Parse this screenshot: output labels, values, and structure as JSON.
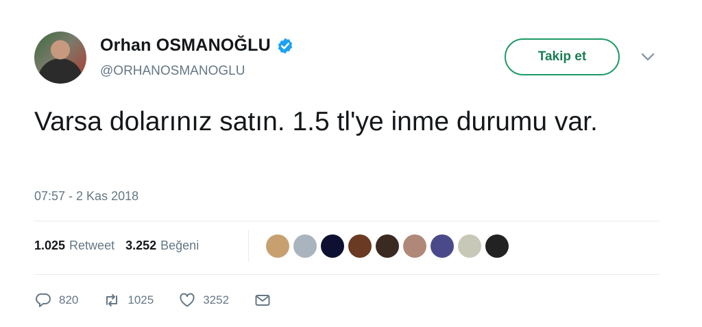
{
  "user": {
    "display_name": "Orhan OSMANOĞLU",
    "handle": "@ORHANOSMANOGLU",
    "verified_color": "#1da1f2"
  },
  "follow_button": {
    "label": "Takip et",
    "color": "#1b9a64"
  },
  "tweet": {
    "text": "Varsa dolarınız satın. 1.5 tl'ye inme durumu var.",
    "timestamp": "07:57 - 2 Kas 2018"
  },
  "stats": {
    "retweets": "1.025",
    "retweets_label": "Retweet",
    "likes": "3.252",
    "likes_label": "Beğeni"
  },
  "likers": [
    {
      "name": "liker-1",
      "color": "#c8a070"
    },
    {
      "name": "liker-2",
      "color": "#aab4be"
    },
    {
      "name": "liker-3",
      "color": "#0d1030"
    },
    {
      "name": "liker-4",
      "color": "#6a3a22"
    },
    {
      "name": "liker-5",
      "color": "#3a2a22"
    },
    {
      "name": "liker-6",
      "color": "#b08878"
    },
    {
      "name": "liker-7",
      "color": "#4a4a8a"
    },
    {
      "name": "liker-8",
      "color": "#c8c8b8"
    },
    {
      "name": "liker-9",
      "color": "#222222"
    }
  ],
  "actions": {
    "reply_count": "820",
    "retweet_count": "1025",
    "like_count": "3252"
  },
  "icons": [
    "reply-icon",
    "retweet-icon",
    "like-icon",
    "message-icon",
    "verified-icon",
    "chevron-down-icon"
  ]
}
